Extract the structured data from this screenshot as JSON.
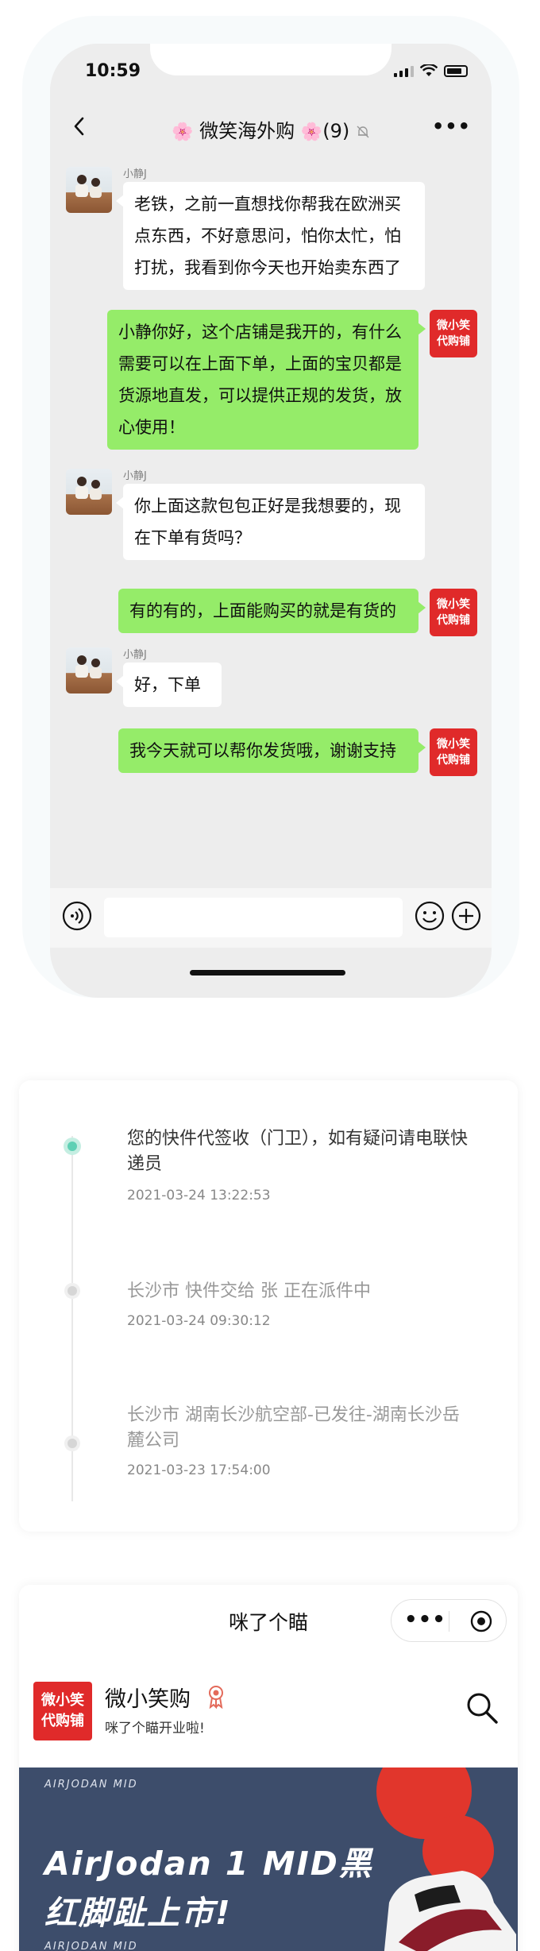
{
  "status_bar": {
    "time": "10:59"
  },
  "chat": {
    "title_prefix_icon": "🌸",
    "title": "微笑海外购",
    "title_suffix_icon": "🌸",
    "member_count": "(9)",
    "messages": [
      {
        "side": "in",
        "sender": "小静J",
        "text": "老铁，之前一直想找你帮我在欧洲买点东西，不好意思问，怕你太忙，怕打扰，我看到你今天也开始卖东西了"
      },
      {
        "side": "out",
        "avatar_text": [
          "微小笑",
          "代购铺"
        ],
        "text": "小静你好，这个店铺是我开的，有什么需要可以在上面下单，上面的宝贝都是货源地直发，可以提供正规的发货，放心使用！"
      },
      {
        "side": "in",
        "sender": "小静J",
        "text": "你上面这款包包正好是我想要的，现在下单有货吗？"
      },
      {
        "side": "out",
        "avatar_text": [
          "微小笑",
          "代购铺"
        ],
        "text": "有的有的，上面能购买的就是有货的"
      },
      {
        "side": "in",
        "sender": "小静J",
        "text": "好，下单"
      },
      {
        "side": "out",
        "avatar_text": [
          "微小笑",
          "代购铺"
        ],
        "text": "我今天就可以帮你发货哦，谢谢支持"
      }
    ]
  },
  "tracking": {
    "events": [
      {
        "text": "您的快件代签收（门卫），如有疑问请电联快递员",
        "time": "2021-03-24  13:22:53",
        "active": true
      },
      {
        "text": "长沙市 快件交给 张 正在派件中",
        "time": "2021-03-24  09:30:12",
        "active": false
      },
      {
        "text": "长沙市 湖南长沙航空部-已发往-湖南长沙岳麓公司",
        "time": "2021-03-23  17:54:00",
        "active": false
      }
    ],
    "colors": {
      "active_dot": "#5fd0b4",
      "inactive_dot": "#d6d6d6"
    }
  },
  "mini_program": {
    "title": "咪了个瞄",
    "shop_logo_text": [
      "微小笑",
      "代购铺"
    ],
    "shop_name": "微小笑购",
    "shop_subtitle": "咪了个瞄开业啦!",
    "banner": {
      "brand_top": "AIRJODAN    MID",
      "brand_bottom": "AIRJODAN    MID",
      "headline_line1": "AirJodan 1 MID黑",
      "headline_line2": "红脚趾上市!"
    }
  },
  "icons": [
    "back-arrow-icon",
    "bell-muted-icon",
    "more-icon",
    "voice-icon",
    "emoji-icon",
    "plus-icon",
    "medal-icon",
    "search-icon",
    "target-icon"
  ],
  "accent": {
    "wechat_green": "#95ec69",
    "shop_red": "#e02a2a"
  }
}
